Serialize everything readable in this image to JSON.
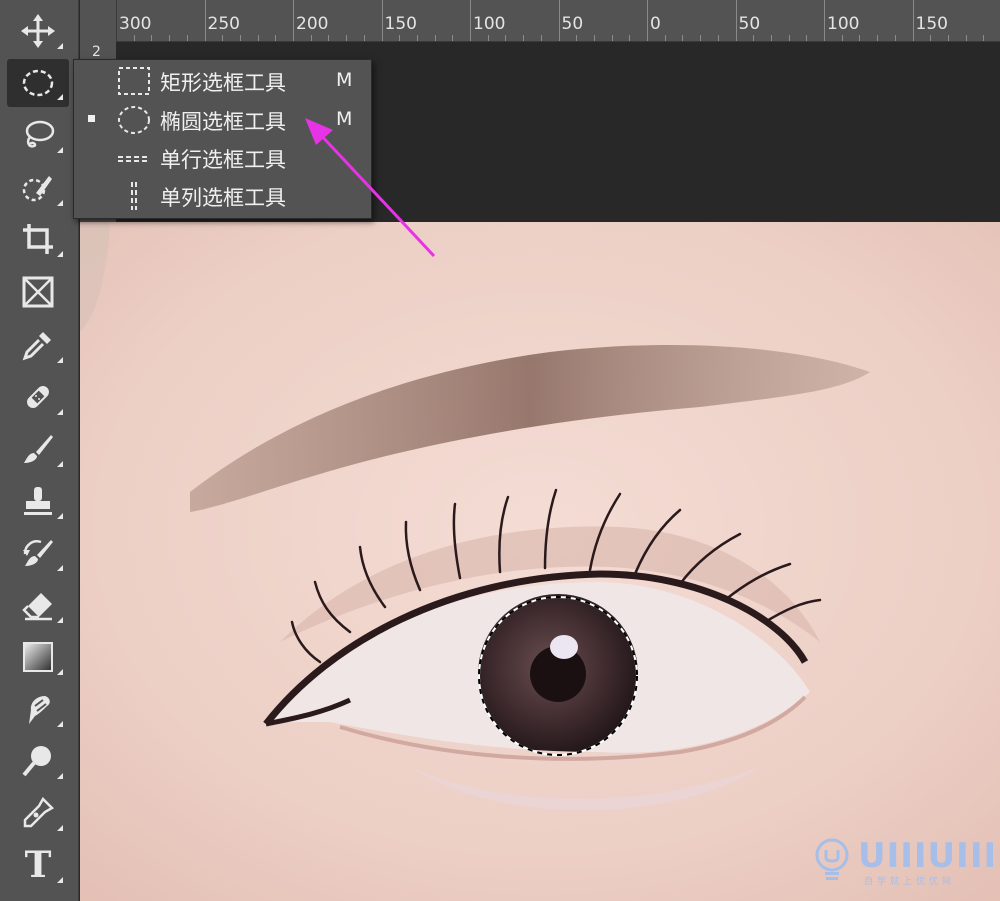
{
  "ruler": {
    "top_ticks": [
      "300",
      "250",
      "200",
      "150",
      "100",
      "50",
      "0",
      "50",
      "100",
      "150"
    ],
    "left_label": "2"
  },
  "toolbar": {
    "tools": [
      {
        "name": "move-tool",
        "icon": "move-icon"
      },
      {
        "name": "marquee-tool",
        "icon": "elliptical-marquee-icon",
        "active": true
      },
      {
        "name": "lasso-tool",
        "icon": "lasso-icon"
      },
      {
        "name": "quick-selection-tool",
        "icon": "quick-selection-icon"
      },
      {
        "name": "crop-tool",
        "icon": "crop-icon"
      },
      {
        "name": "frame-tool",
        "icon": "frame-icon"
      },
      {
        "name": "eyedropper-tool",
        "icon": "eyedropper-icon"
      },
      {
        "name": "healing-brush-tool",
        "icon": "bandage-icon"
      },
      {
        "name": "brush-tool",
        "icon": "brush-icon"
      },
      {
        "name": "clone-stamp-tool",
        "icon": "stamp-icon"
      },
      {
        "name": "history-brush-tool",
        "icon": "history-brush-icon"
      },
      {
        "name": "eraser-tool",
        "icon": "eraser-icon"
      },
      {
        "name": "gradient-tool",
        "icon": "gradient-icon"
      },
      {
        "name": "smudge-tool",
        "icon": "smudge-icon"
      },
      {
        "name": "dodge-tool",
        "icon": "dodge-icon"
      },
      {
        "name": "pen-tool",
        "icon": "pen-icon"
      },
      {
        "name": "type-tool",
        "icon": "type-icon"
      }
    ],
    "type_glyph": "T"
  },
  "flyout": {
    "items": [
      {
        "label": "矩形选框工具",
        "shortcut": "M",
        "selected": false,
        "icon": "rectangular-marquee-icon"
      },
      {
        "label": "椭圆选框工具",
        "shortcut": "M",
        "selected": true,
        "icon": "elliptical-marquee-icon"
      },
      {
        "label": "单行选框工具",
        "shortcut": "",
        "selected": false,
        "icon": "single-row-marquee-icon"
      },
      {
        "label": "单列选框工具",
        "shortcut": "",
        "selected": false,
        "icon": "single-column-marquee-icon"
      }
    ]
  },
  "watermark": {
    "text": "UIIIUIII",
    "subtext": "自学就上优优网"
  },
  "colors": {
    "panel": "#535353",
    "pasteboard": "#282828",
    "annotation_arrow": "#e633e6",
    "watermark": "#a6bee8"
  }
}
